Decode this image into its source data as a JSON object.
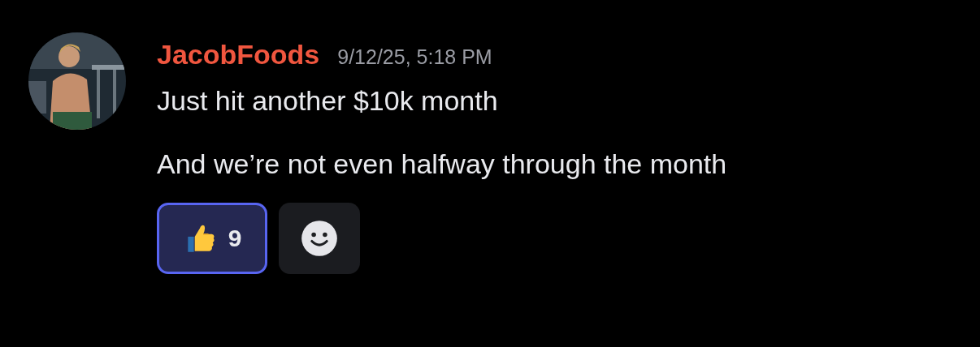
{
  "message": {
    "author": "JacobFoods",
    "timestamp": "9/12/25, 5:18 PM",
    "lines": [
      "Just hit another $10k month",
      "And we’re not even halfway through the month"
    ],
    "reactions": [
      {
        "kind": "emoji",
        "count": "9",
        "selected": true
      },
      {
        "kind": "add"
      }
    ]
  }
}
